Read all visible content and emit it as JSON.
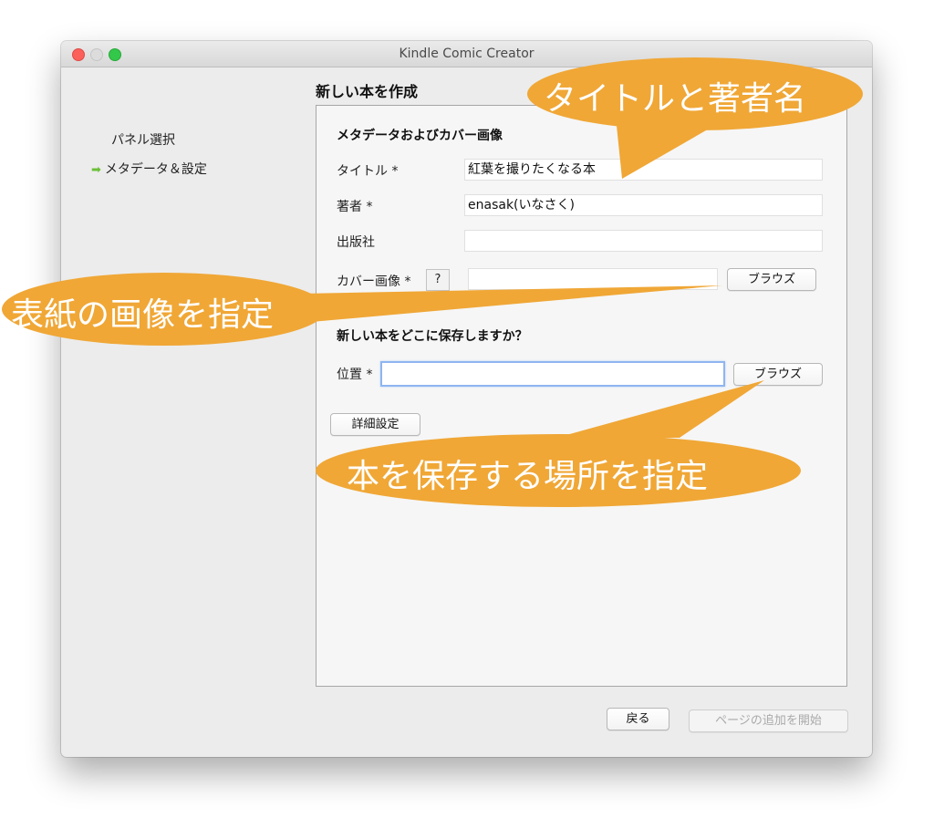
{
  "window": {
    "title": "Kindle Comic Creator"
  },
  "sidebar": {
    "items": [
      {
        "label": "パネル選択",
        "active": false
      },
      {
        "label": "メタデータ＆設定",
        "active": true,
        "arrow": "➡"
      }
    ]
  },
  "page": {
    "title": "新しい本を作成"
  },
  "metadata": {
    "section_title": "メタデータおよびカバー画像",
    "title_label": "タイトル *",
    "title_value": "紅葉を撮りたくなる本",
    "author_label": "著者 *",
    "author_value": "enasak(いなさく)",
    "publisher_label": "出版社",
    "publisher_value": "",
    "cover_label": "カバー画像 *",
    "help_label": "?",
    "cover_value": "",
    "browse_label": "ブラウズ"
  },
  "save": {
    "section_title": "新しい本をどこに保存しますか？",
    "location_label": "位置 *",
    "location_value": "",
    "browse_label": "ブラウズ",
    "advanced_label": "詳細設定"
  },
  "footer": {
    "back_label": "戻る",
    "start_label": "ページの追加を開始"
  },
  "annotations": {
    "color": "#f0a736",
    "title_author": "タイトルと著者名",
    "cover": "表紙の画像を指定",
    "location": "本を保存する場所を指定"
  }
}
